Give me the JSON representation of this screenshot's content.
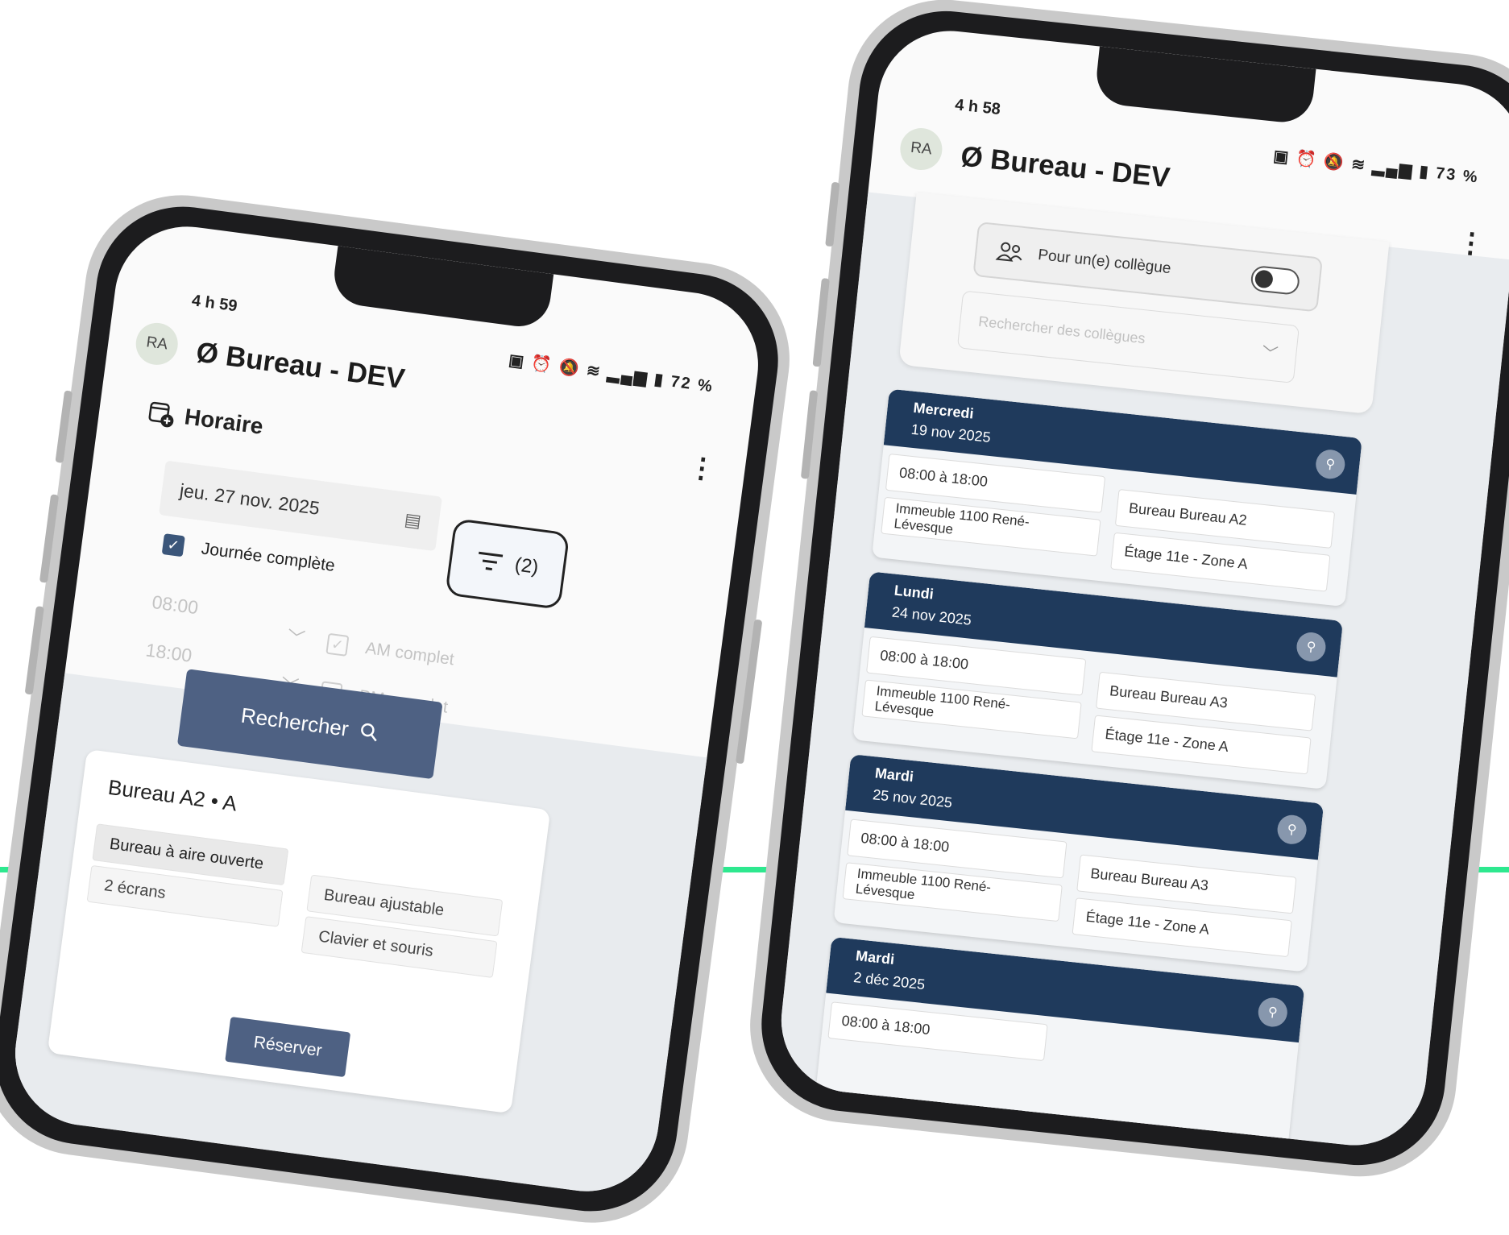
{
  "colors": {
    "accent_line": "#2ee88f",
    "primary": "#1f3a5c",
    "button": "#4e6183"
  },
  "left_phone": {
    "status": {
      "time": "4 h 59",
      "battery": "72 %"
    },
    "app": {
      "avatar": "RA",
      "title": "Ø Bureau - DEV"
    },
    "schedule": {
      "title": "Horaire",
      "date": "jeu. 27 nov. 2025",
      "full_day_label": "Journée complète",
      "start_time": "08:00",
      "end_time": "18:00",
      "am_label": "AM complet",
      "pm_label": "PM complet",
      "filter_count": "(2)",
      "search_label": "Rechercher"
    },
    "result": {
      "title": "Bureau A2 • A",
      "features": [
        "Bureau à aire ouverte",
        "2 écrans",
        "Bureau ajustable",
        "Clavier et souris"
      ],
      "reserve_label": "Réserver"
    }
  },
  "right_phone": {
    "status": {
      "time": "4 h 58",
      "battery": "73 %"
    },
    "app": {
      "avatar": "RA",
      "title": "Ø Bureau - DEV"
    },
    "colleague": {
      "label": "Pour un(e) collègue",
      "search_placeholder": "Rechercher des collègues"
    },
    "reservations": [
      {
        "day": "Mercredi",
        "date": "19 nov 2025",
        "time": "08:00 à 18:00",
        "desk": "Bureau Bureau A2",
        "building": "Immeuble 1100 René-Lévesque",
        "floor": "Étage 11e - Zone A"
      },
      {
        "day": "Lundi",
        "date": "24 nov 2025",
        "time": "08:00 à 18:00",
        "desk": "Bureau Bureau A3",
        "building": "Immeuble 1100 René-Lévesque",
        "floor": "Étage 11e - Zone A"
      },
      {
        "day": "Mardi",
        "date": "25 nov 2025",
        "time": "08:00 à 18:00",
        "desk": "Bureau Bureau A3",
        "building": "Immeuble 1100 René-Lévesque",
        "floor": "Étage 11e - Zone A"
      },
      {
        "day": "Mardi",
        "date": "2 déc 2025",
        "time": "08:00 à 18:00",
        "desk": "",
        "building": "",
        "floor": ""
      }
    ]
  }
}
